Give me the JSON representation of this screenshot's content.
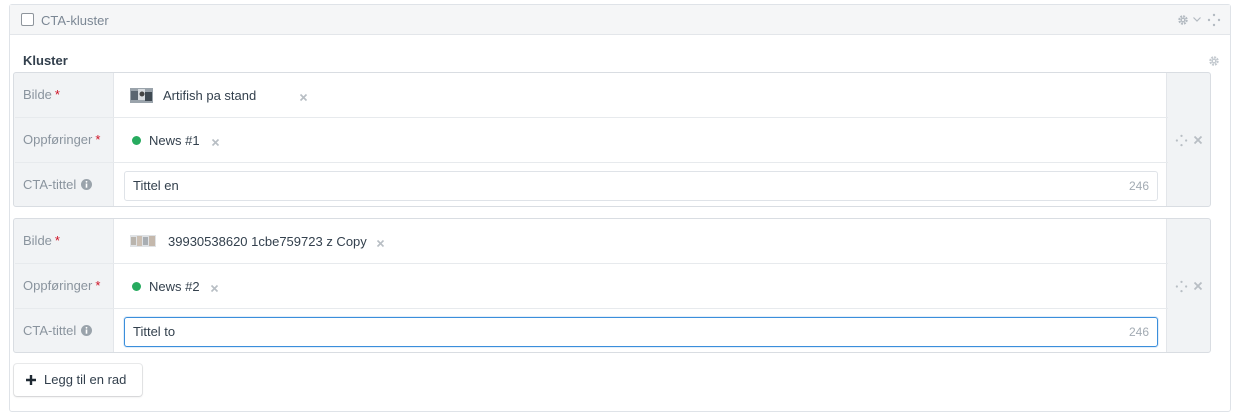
{
  "header": {
    "title": "CTA-kluster",
    "icons": [
      "gear-icon",
      "chevron-down-icon",
      "move-icon"
    ]
  },
  "section": {
    "label": "Kluster",
    "icon": "gear-icon"
  },
  "labels": {
    "image": "Bilde",
    "entries": "Oppføringer",
    "cta_title": "CTA-tittel",
    "required_mark": "*"
  },
  "blocks": [
    {
      "image": {
        "name": "Artifish pa stand"
      },
      "entry": {
        "name": "News #1",
        "status_color": "#27ab5f"
      },
      "cta_title": {
        "value": "Tittel en",
        "remaining": "246"
      }
    },
    {
      "image": {
        "name": "39930538620 1cbe759723 z Copy"
      },
      "entry": {
        "name": "News #2",
        "status_color": "#27ab5f"
      },
      "cta_title": {
        "value": "Tittel to",
        "remaining": "246",
        "focused": true
      }
    }
  ],
  "add_row": {
    "label": "Legg til en rad",
    "icon": "plus-icon"
  },
  "colors": {
    "focus": "#3b8edb",
    "required": "#cf1124",
    "live_status": "#27ab5f"
  }
}
